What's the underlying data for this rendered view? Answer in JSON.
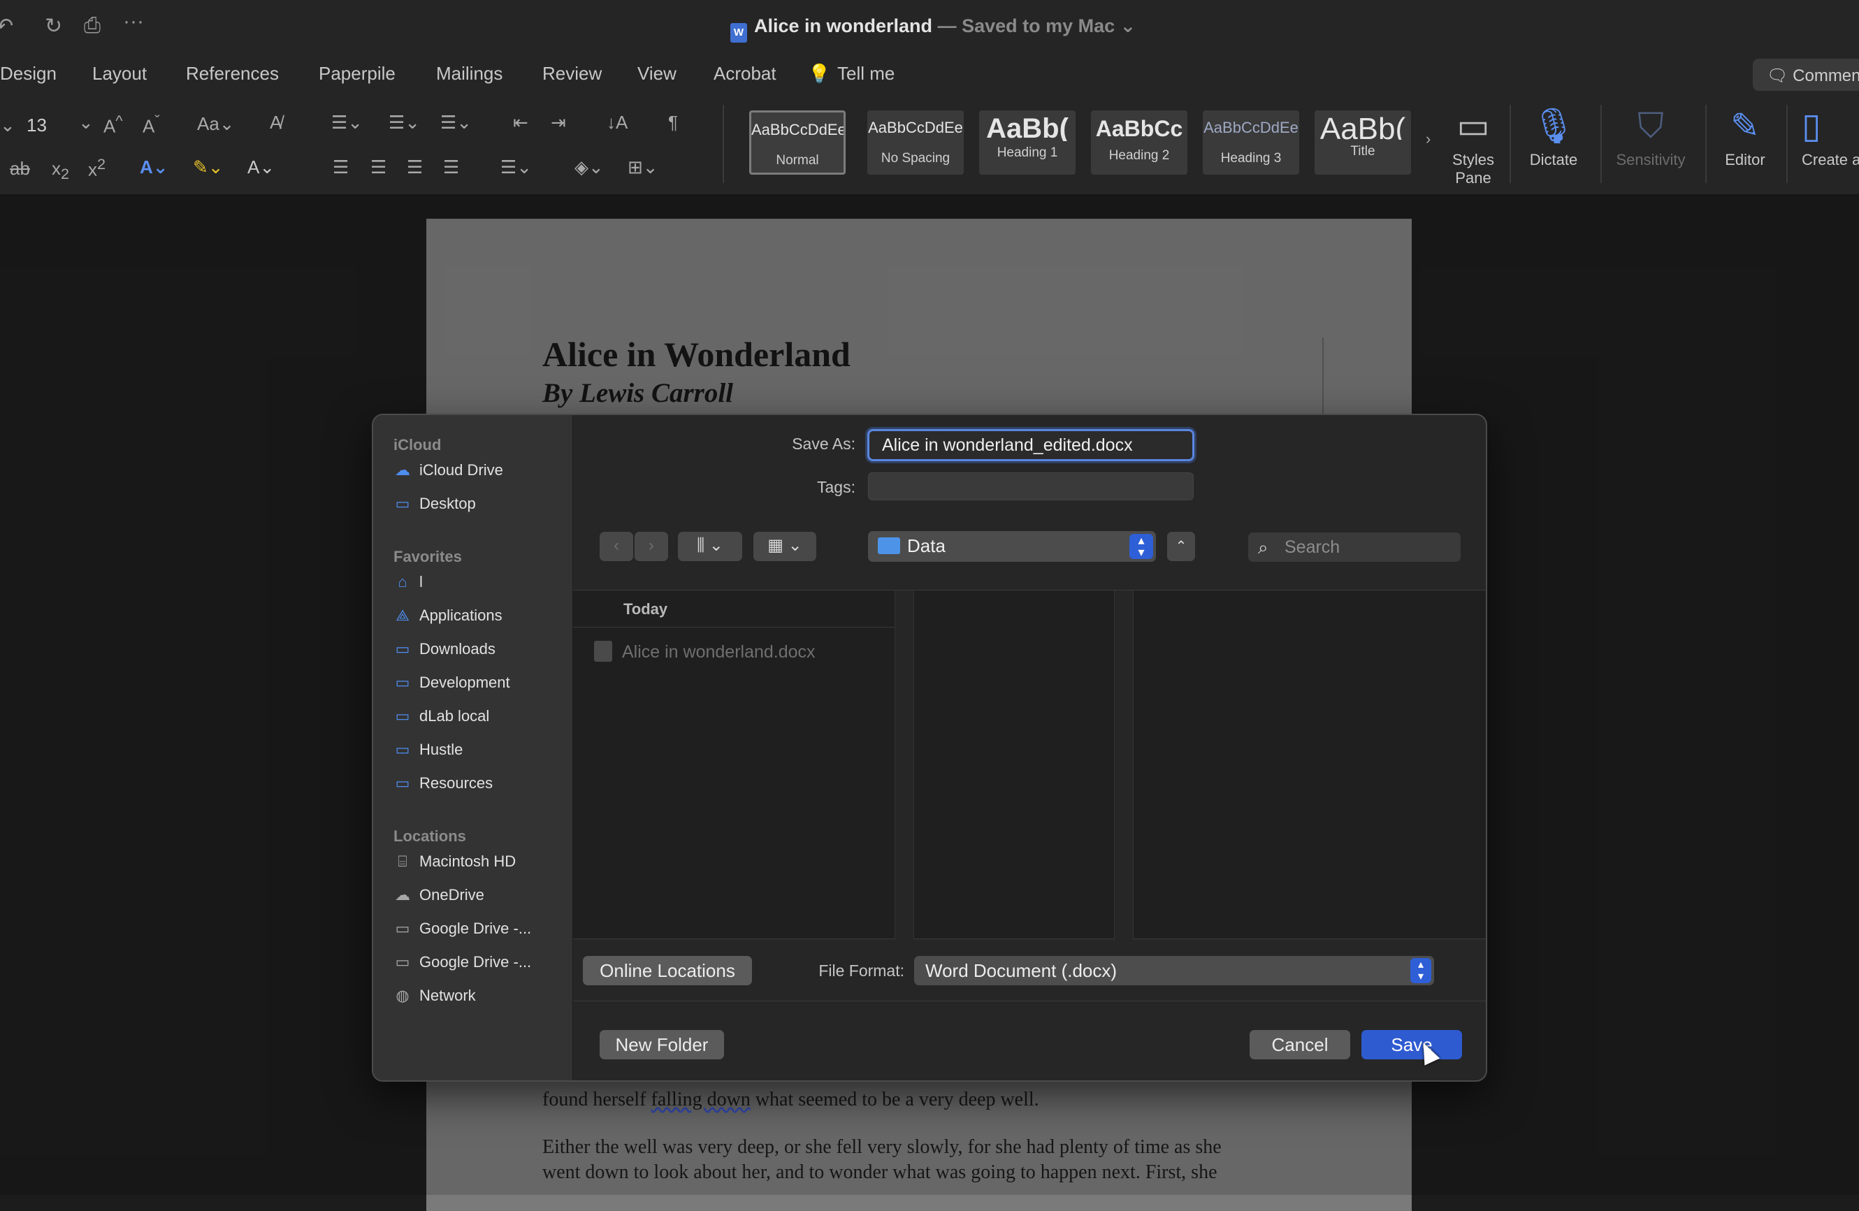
{
  "window": {
    "title": "Alice in wonderland",
    "title_suffix": "— Saved to my Mac",
    "title_chevron": "⌄"
  },
  "quick_access": {
    "undo_icon": "↶",
    "redo_icon": "↻",
    "print_icon": "⎙",
    "more_icon": "···"
  },
  "menu": {
    "tabs": [
      "Design",
      "Layout",
      "References",
      "Paperpile",
      "Mailings",
      "Review",
      "View",
      "Acrobat"
    ],
    "tell_me": "Tell me",
    "comment_button": "Commen"
  },
  "ribbon": {
    "font_size": "13",
    "styles": [
      {
        "preview": "AaBbCcDdEe",
        "label": "Normal",
        "selected": true
      },
      {
        "preview": "AaBbCcDdEe",
        "label": "No Spacing",
        "selected": false
      },
      {
        "preview": "AaBb(",
        "label": "Heading 1",
        "selected": false
      },
      {
        "preview": "AaBbCc",
        "label": "Heading 2",
        "selected": false
      },
      {
        "preview": "AaBbCcDdEe",
        "label": "Heading 3",
        "selected": false
      },
      {
        "preview": "AaBb(",
        "label": "Title",
        "selected": false
      }
    ],
    "styles_pane": "Styles Pane",
    "dictate": "Dictate",
    "sensitivity": "Sensitivity",
    "editor": "Editor",
    "create_adobe": "Create a Adob"
  },
  "document": {
    "heading": "Alice in Wonderland",
    "byline": "By Lewis Carroll",
    "line1_prefix": "found herself ",
    "line1_link": "falling down",
    "line1_suffix": " what seemed to be a very deep well.",
    "para2_line1": "Either the well was very deep, or she fell very slowly, for she had plenty of time as she",
    "para2_line2": "went down to look about her, and to wonder what was going to happen next. First, she"
  },
  "dialog": {
    "save_as_label": "Save As:",
    "save_as_value": "Alice in wonderland_edited.docx",
    "tags_label": "Tags:",
    "location": "Data",
    "search_placeholder": "Search",
    "sidebar": {
      "icloud_header": "iCloud",
      "icloud_items": [
        "iCloud Drive",
        "Desktop"
      ],
      "favorites_header": "Favorites",
      "favorites_items": [
        "l",
        "Applications",
        "Downloads",
        "Development",
        "dLab local",
        "Hustle",
        "Resources"
      ],
      "locations_header": "Locations",
      "locations_items": [
        "Macintosh HD",
        "OneDrive",
        "Google Drive -...",
        "Google Drive -...",
        "Network"
      ]
    },
    "browser": {
      "group_header": "Today",
      "files": [
        "Alice in wonderland.docx"
      ]
    },
    "online_locations": "Online Locations",
    "file_format_label": "File Format:",
    "file_format_value": "Word Document (.docx)",
    "new_folder": "New Folder",
    "cancel": "Cancel",
    "save": "Save"
  }
}
